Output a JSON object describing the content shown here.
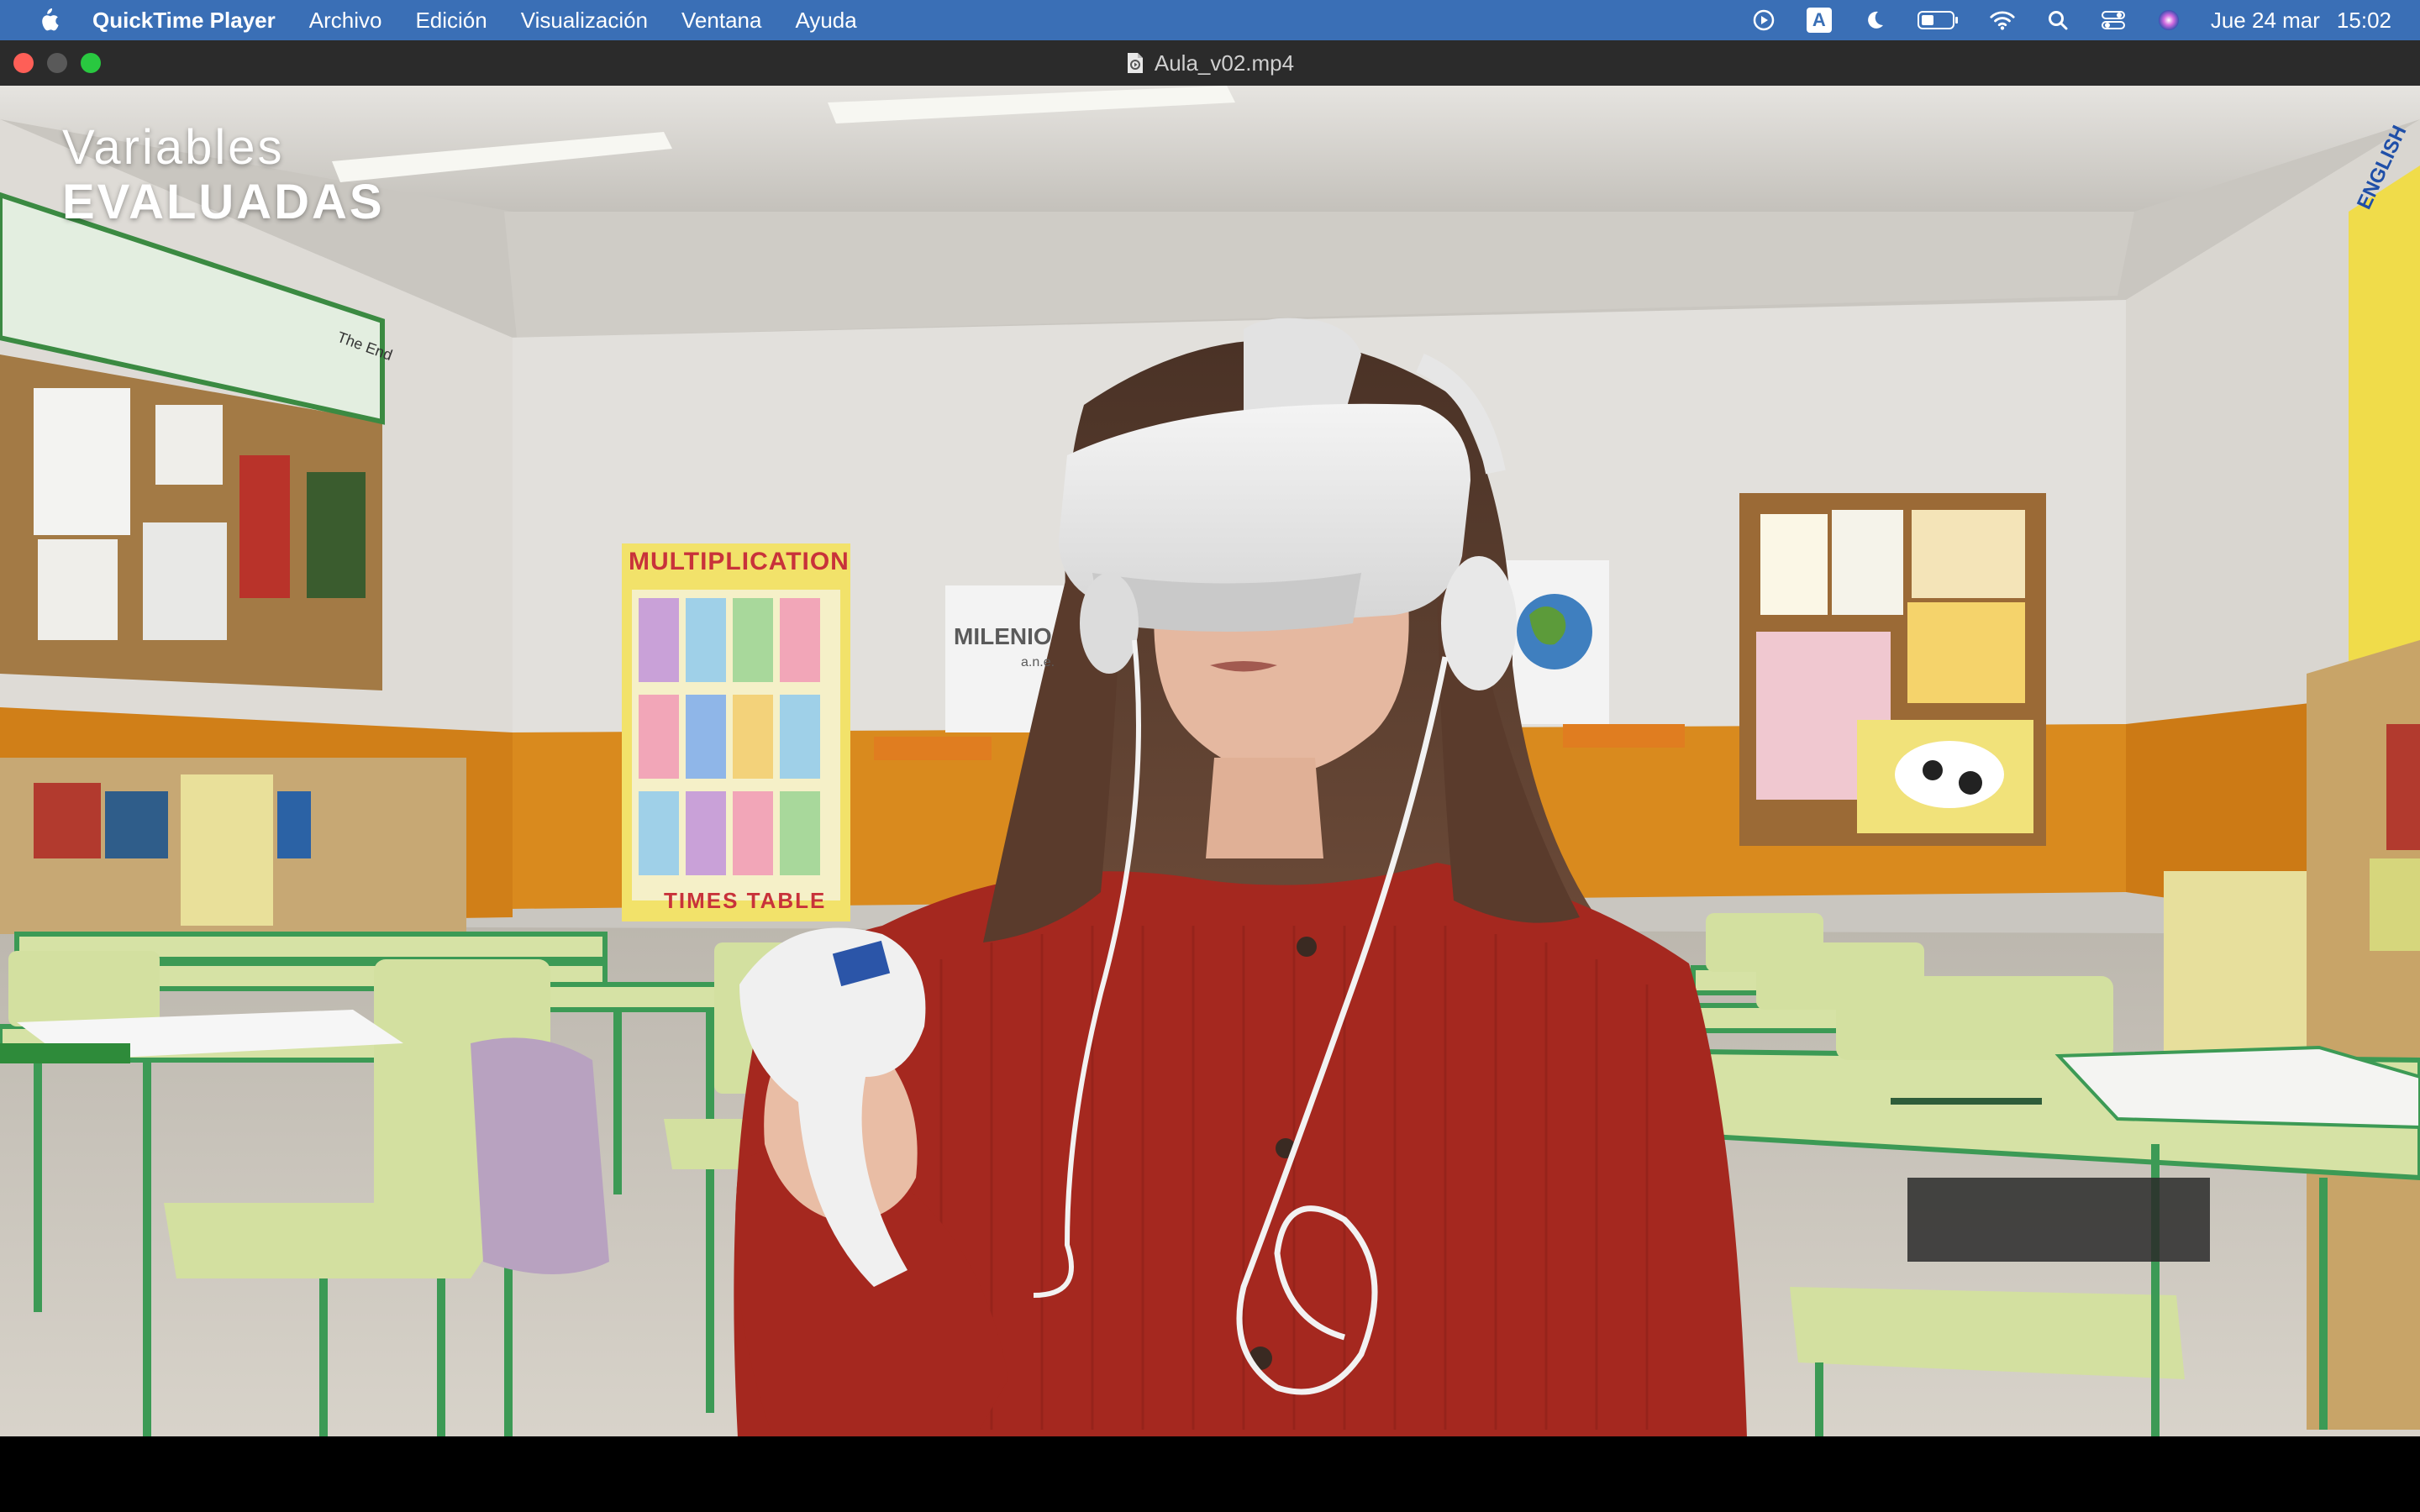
{
  "menubar": {
    "app_name": "QuickTime Player",
    "items": [
      "Archivo",
      "Edición",
      "Visualización",
      "Ventana",
      "Ayuda"
    ],
    "status_icons": [
      "play-circle-icon",
      "keyboard-input-a-icon",
      "moon-icon",
      "battery-icon",
      "wifi-icon",
      "search-icon",
      "control-center-icon",
      "siri-icon"
    ],
    "input_badge": "A",
    "date": "Jue 24 mar",
    "time": "15:02"
  },
  "window": {
    "title": "Aula_v02.mp4"
  },
  "video": {
    "overlay_line1": "Variables",
    "overlay_line2": "EVALUADAS",
    "poster_multiplication": "MULTIPLICATION",
    "poster_times_table": "TIMES TABLE",
    "logo_text": "MILENIO",
    "logo_sub": "a.n.e.",
    "poster_english": "ENGLISH",
    "corkboard_text": "The End"
  },
  "colors": {
    "menubar": "#3a6fb6",
    "titlebar": "#2b2b2b",
    "close": "#fe5f57",
    "minimize": "#595959",
    "zoom": "#29c840",
    "wall_orange": "#d98a1e",
    "sweater": "#a5281f"
  }
}
